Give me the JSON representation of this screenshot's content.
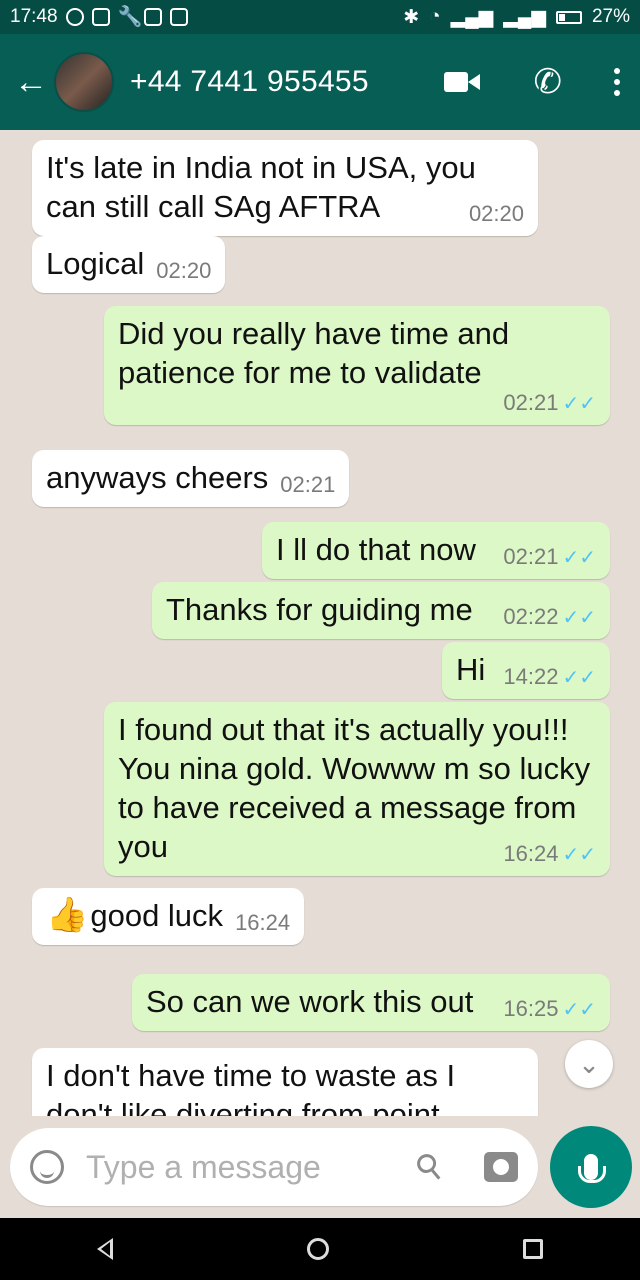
{
  "status_bar": {
    "time": "17:48",
    "battery": "27%"
  },
  "header": {
    "contact": "+44 7441 955455",
    "icons": [
      "back-arrow-icon",
      "video-call-icon",
      "phone-icon",
      "more-options-icon"
    ]
  },
  "messages": [
    {
      "dir": "in",
      "text": "It's late in India not in USA, you can still call SAg AFTRA",
      "time": "02:20"
    },
    {
      "dir": "in",
      "text": "Logical",
      "time": "02:20"
    },
    {
      "dir": "out",
      "text": "Did you really have time and patience for me to validate",
      "time": "02:21",
      "ticks": "✓✓"
    },
    {
      "dir": "in",
      "text": "anyways cheers",
      "time": "02:21"
    },
    {
      "dir": "out",
      "text": "I ll do that now",
      "time": "02:21",
      "ticks": "✓✓"
    },
    {
      "dir": "out",
      "text": "Thanks for guiding me",
      "time": "02:22",
      "ticks": "✓✓"
    },
    {
      "dir": "out",
      "text": "Hi",
      "time": "14:22",
      "ticks": "✓✓"
    },
    {
      "dir": "out",
      "text": "I found out that it's actually you!!! You nina gold. Wowww m so lucky to have received a message from you",
      "time": "16:24",
      "ticks": "✓✓"
    },
    {
      "dir": "in",
      "emoji": "👍",
      "text": "good luck",
      "time": "16:24"
    },
    {
      "dir": "out",
      "text": "So can we work this out",
      "time": "16:25",
      "ticks": "✓✓"
    },
    {
      "dir": "in",
      "text": "I don't have time to waste as I don't like diverting from point",
      "time": ""
    }
  ],
  "composer": {
    "placeholder": "Type a message"
  },
  "colors": {
    "header": "#075e54",
    "status_bar": "#054d44",
    "outgoing_bubble": "#dcf8c6",
    "incoming_bubble": "#ffffff",
    "chat_background": "#e5ddd5",
    "mic_button": "#00897b",
    "read_ticks": "#4fc3f7"
  }
}
